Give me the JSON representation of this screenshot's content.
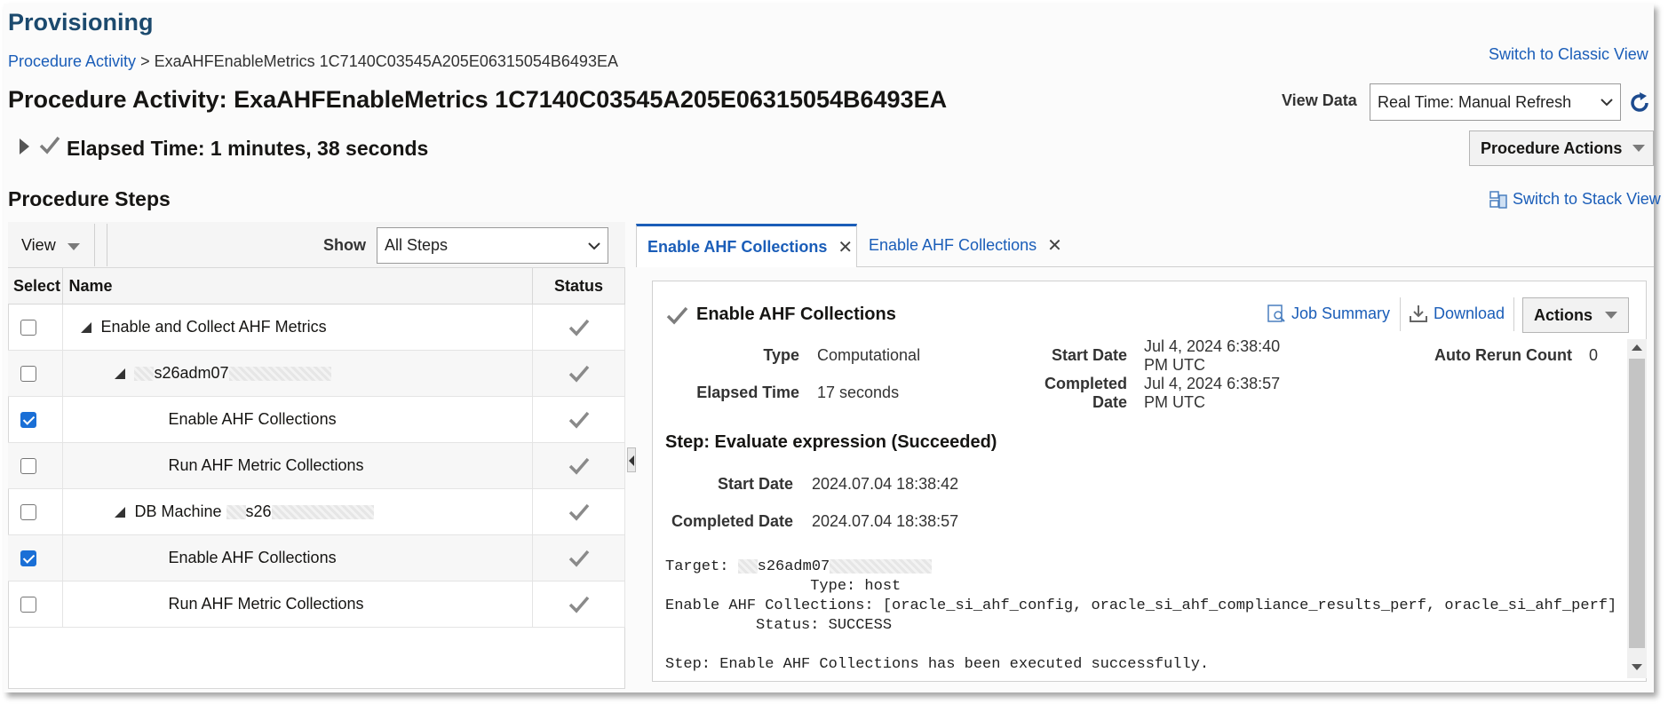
{
  "header": {
    "title": "Provisioning",
    "breadcrumb_link": "Procedure Activity",
    "breadcrumb_sep": ">",
    "breadcrumb_current": "ExaAHFEnableMetrics 1C7140C03545A205E06315054B6493EA",
    "classic_link": "Switch to Classic View",
    "page_heading": "Procedure Activity: ExaAHFEnableMetrics 1C7140C03545A205E06315054B6493EA",
    "view_data_label": "View Data",
    "view_data_value": "Real Time: Manual Refresh",
    "elapsed": "Elapsed Time: 1 minutes, 38 seconds",
    "procedure_actions": "Procedure Actions"
  },
  "steps": {
    "title": "Procedure Steps",
    "stack_view_link": "Switch to Stack View",
    "view_label": "View",
    "show_label": "Show",
    "show_value": "All Steps",
    "columns": [
      "Select",
      "Name",
      "Status"
    ],
    "rows": [
      {
        "name": "Enable and Collect AHF Metrics",
        "checked": false
      },
      {
        "name": "s26adm07",
        "checked": false
      },
      {
        "name": "Enable AHF Collections",
        "checked": true
      },
      {
        "name": "Run AHF Metric Collections",
        "checked": false
      },
      {
        "name": "DB Machine",
        "name_suffix": "s26",
        "checked": false
      },
      {
        "name": "Enable AHF Collections",
        "checked": true
      },
      {
        "name": "Run AHF Metric Collections",
        "checked": false
      }
    ]
  },
  "tabs": [
    {
      "label": "Enable AHF Collections",
      "active": true
    },
    {
      "label": "Enable AHF Collections",
      "active": false
    }
  ],
  "detail": {
    "title": "Enable AHF Collections",
    "job_summary": "Job Summary",
    "download": "Download",
    "actions": "Actions",
    "type_label": "Type",
    "type_value": "Computational",
    "elapsed_label": "Elapsed Time",
    "elapsed_value": "17 seconds",
    "start_label": "Start Date",
    "start_value_1": "Jul 4, 2024 6:38:40",
    "start_value_2": "PM UTC",
    "completed_label_1": "Completed",
    "completed_label_2": "Date",
    "completed_value_1": "Jul 4, 2024 6:38:57",
    "completed_value_2": "PM UTC",
    "rerun_label": "Auto Rerun Count",
    "rerun_value": "0",
    "step_heading": "Step: Evaluate expression (Succeeded)",
    "step_start_label": "Start Date",
    "step_start_value": "2024.07.04 18:38:42",
    "step_completed_label": "Completed Date",
    "step_completed_value": "2024.07.04 18:38:57",
    "log_target_prefix": "Target: ",
    "log_target": "s26adm07",
    "log_type": "                Type: host",
    "log_collections": "Enable AHF Collections: [oracle_si_ahf_config, oracle_si_ahf_compliance_results_perf, oracle_si_ahf_perf]",
    "log_status": "          Status: SUCCESS",
    "log_result": "Step: Enable AHF Collections has been executed successfully."
  },
  "colors": {
    "link": "#1a5db8",
    "title": "#1c4a6e",
    "check_on": "#1a6fd6"
  }
}
